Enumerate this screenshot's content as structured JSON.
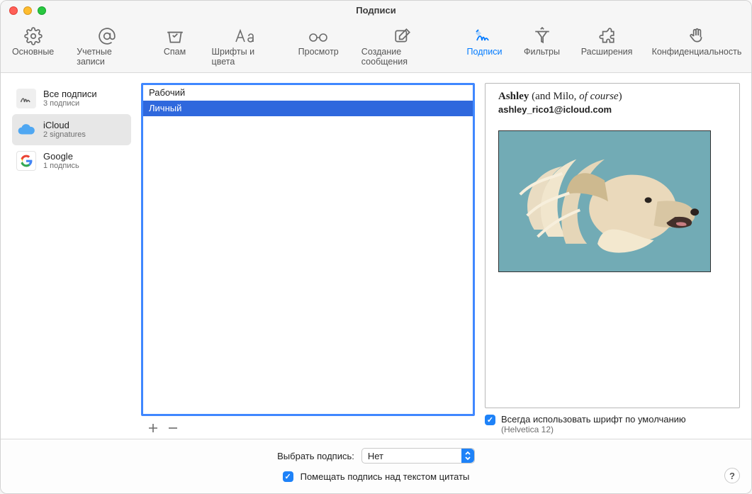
{
  "window": {
    "title": "Подписи"
  },
  "toolbar": {
    "items": [
      {
        "label": "Основные"
      },
      {
        "label": "Учетные записи"
      },
      {
        "label": "Спам"
      },
      {
        "label": "Шрифты и цвета"
      },
      {
        "label": "Просмотр"
      },
      {
        "label": "Создание сообщения"
      },
      {
        "label": "Подписи"
      },
      {
        "label": "Фильтры"
      },
      {
        "label": "Расширения"
      },
      {
        "label": "Конфиденциальность"
      }
    ],
    "active_index": 6
  },
  "accounts": [
    {
      "name": "Все подписи",
      "sub": "3 подписи"
    },
    {
      "name": "iCloud",
      "sub": "2 signatures"
    },
    {
      "name": "Google",
      "sub": "1 подпись"
    }
  ],
  "accounts_selected_index": 1,
  "signatures": [
    {
      "name": "Рабочий"
    },
    {
      "name": "Личный"
    }
  ],
  "signatures_selected_index": 1,
  "signature_preview": {
    "name_first": "Ashley",
    "name_rest": " (and Milo, ",
    "name_italic": "of course",
    "name_close": ")",
    "email": "ashley_rico1@icloud.com"
  },
  "default_font": {
    "label": "Всегда использовать шрифт по умолчанию",
    "sub": "(Helvetica 12)",
    "checked": true
  },
  "bottom": {
    "select_label": "Выбрать подпись:",
    "select_value": "Нет",
    "over_quote_label": "Помещать подпись над текстом цитаты",
    "over_quote_checked": true
  }
}
